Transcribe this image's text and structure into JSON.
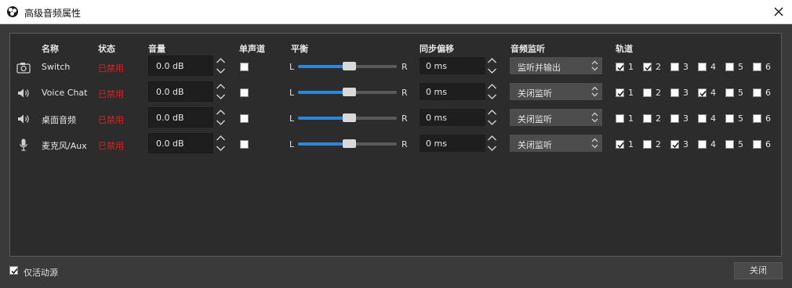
{
  "window": {
    "title": "高级音频属性",
    "close_label": "关闭"
  },
  "headers": {
    "name": "名称",
    "status": "状态",
    "volume": "音量",
    "mono": "单声道",
    "balance": "平衡",
    "sync": "同步偏移",
    "monitor": "音频监听",
    "tracks": "轨道"
  },
  "balance_labels": {
    "left": "L",
    "right": "R"
  },
  "rows": [
    {
      "icon": "camera-icon",
      "name": "Switch",
      "status": "已禁用",
      "volume": "0.0 dB",
      "mono": false,
      "balance": 0.5,
      "sync": "0 ms",
      "monitor": "监听并输出",
      "tracks": [
        true,
        true,
        false,
        false,
        false,
        false
      ]
    },
    {
      "icon": "speaker-icon",
      "name": "Voice Chat",
      "status": "已禁用",
      "volume": "0.0 dB",
      "mono": false,
      "balance": 0.5,
      "sync": "0 ms",
      "monitor": "关闭监听",
      "tracks": [
        true,
        false,
        false,
        true,
        false,
        false
      ]
    },
    {
      "icon": "speaker-icon",
      "name": "桌面音频",
      "status": "已禁用",
      "volume": "0.0 dB",
      "mono": false,
      "balance": 0.5,
      "sync": "0 ms",
      "monitor": "关闭监听",
      "tracks": [
        false,
        false,
        false,
        false,
        false,
        false
      ]
    },
    {
      "icon": "microphone-icon",
      "name": "麦克风/Aux",
      "status": "已禁用",
      "volume": "0.0 dB",
      "mono": false,
      "balance": 0.5,
      "sync": "0 ms",
      "monitor": "关闭监听",
      "tracks": [
        true,
        false,
        true,
        false,
        false,
        false
      ]
    }
  ],
  "track_numbers": [
    "1",
    "2",
    "3",
    "4",
    "5",
    "6"
  ],
  "active_only": {
    "label": "仅活动源",
    "checked": true
  }
}
